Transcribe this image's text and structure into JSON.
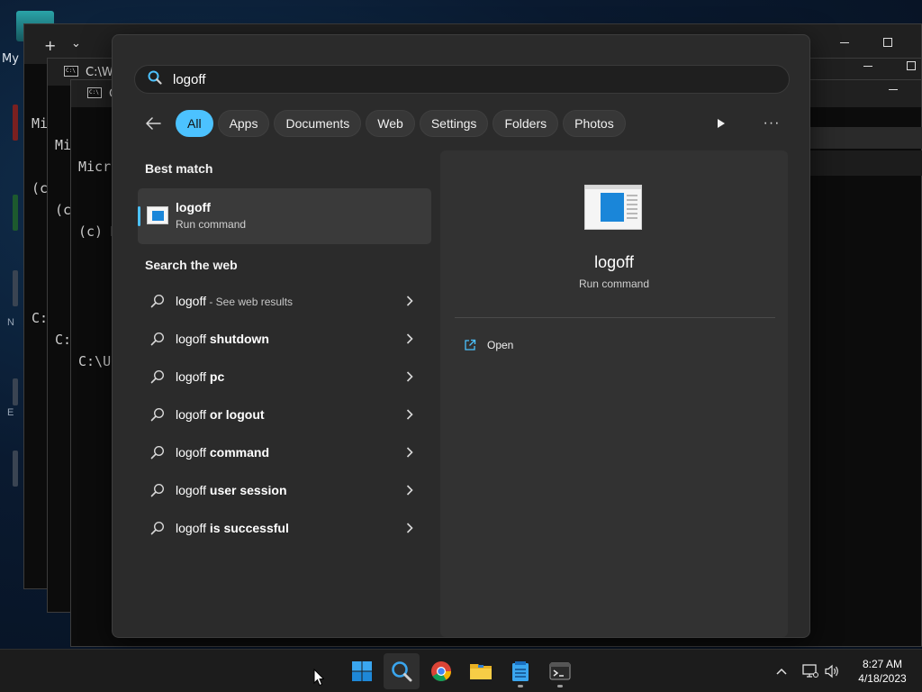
{
  "desktop": {
    "icon_label": "My",
    "side_letters": [
      "N",
      "E"
    ]
  },
  "terminals": {
    "new_tab": "+",
    "dropdown": "⌄",
    "tab_title_1": "C:\\Wi",
    "tab_title_2": "C",
    "lines_a": [
      "Mi",
      "(c",
      "",
      "C:"
    ],
    "lines_b": [
      "Mi",
      "(c",
      "",
      "C:"
    ],
    "lines_c": [
      "Micro",
      "(c) M",
      "",
      "C:\\Us"
    ]
  },
  "search": {
    "query": "logoff",
    "filters": [
      {
        "label": "All",
        "active": true
      },
      {
        "label": "Apps"
      },
      {
        "label": "Documents"
      },
      {
        "label": "Web"
      },
      {
        "label": "Settings"
      },
      {
        "label": "Folders"
      },
      {
        "label": "Photos"
      }
    ],
    "best_match_title": "Best match",
    "best_match": {
      "name": "logoff",
      "type": "Run command"
    },
    "web_title": "Search the web",
    "web_results": [
      {
        "prefix": "logoff",
        "bold": "",
        "suffix": " - See web results"
      },
      {
        "prefix": "logoff",
        "bold": " shutdown",
        "suffix": ""
      },
      {
        "prefix": "logoff",
        "bold": " pc",
        "suffix": ""
      },
      {
        "prefix": "logoff",
        "bold": " or logout",
        "suffix": ""
      },
      {
        "prefix": "logoff",
        "bold": " command",
        "suffix": ""
      },
      {
        "prefix": "logoff",
        "bold": " user session",
        "suffix": ""
      },
      {
        "prefix": "logoff",
        "bold": " is successful",
        "suffix": ""
      }
    ],
    "detail": {
      "name": "logoff",
      "type": "Run command",
      "open_label": "Open"
    },
    "more_label": "···"
  },
  "taskbar": {
    "time": "8:27 AM",
    "date": "4/18/2023"
  },
  "colors": {
    "accent": "#4cc2ff",
    "panel": "#2b2b2b",
    "taskbar": "#1c1c1c"
  }
}
